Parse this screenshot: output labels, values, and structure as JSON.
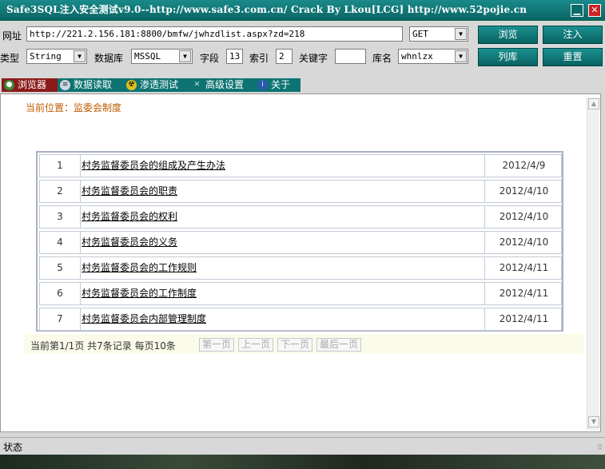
{
  "window": {
    "title": "Safe3SQL注入安全测试v9.0--http://www.safe3.com.cn/   Crack By Lkou[LCG]  http://www.52pojie.cn",
    "minimize_glyph": "▁",
    "close_glyph": "✕"
  },
  "toolbar": {
    "url_label": "网址",
    "url_value": "http://221.2.156.181:8800/bmfw/jwhzdlist.aspx?zd=218",
    "method_value": "GET",
    "type_label": "类型",
    "type_value": "String",
    "db_label": "数据库",
    "db_value": "MSSQL",
    "field_label": "字段",
    "field_value": "13",
    "index_label": "索引",
    "index_value": "2",
    "keyword_label": "关键字",
    "keyword_value": "",
    "dbname_label": "库名",
    "dbname_value": "whnlzx",
    "browse_btn": "浏览",
    "inject_btn": "注入",
    "listdb_btn": "列库",
    "reset_btn": "重置",
    "arrow_glyph": "▼"
  },
  "tabs": [
    {
      "label": "浏览器",
      "icon": "globe-icon",
      "glyph": "●"
    },
    {
      "label": "数据读取",
      "icon": "database-icon",
      "glyph": "≡"
    },
    {
      "label": "渗透测试",
      "icon": "radiation-icon",
      "glyph": "☢"
    },
    {
      "label": "高级设置",
      "icon": "tools-icon",
      "glyph": "✕"
    },
    {
      "label": "关于",
      "icon": "info-icon",
      "glyph": "i"
    }
  ],
  "page": {
    "location": "当前位置：监委会制度",
    "rows": [
      {
        "num": "1",
        "title": "村务监督委员会的组成及产生办法",
        "date": "2012/4/9"
      },
      {
        "num": "2",
        "title": "村务监督委员会的职责",
        "date": "2012/4/10"
      },
      {
        "num": "3",
        "title": "村务监督委员会的权利",
        "date": "2012/4/10"
      },
      {
        "num": "4",
        "title": "村务监督委员会的义务",
        "date": "2012/4/10"
      },
      {
        "num": "5",
        "title": "村务监督委员会的工作规则",
        "date": "2012/4/11"
      },
      {
        "num": "6",
        "title": "村务监督委员会的工作制度",
        "date": "2012/4/11"
      },
      {
        "num": "7",
        "title": "村务监督委员会内部管理制度",
        "date": "2012/4/11"
      }
    ],
    "pager_info": "当前第1/1页  共7条记录  每页10条",
    "first_page": "第一页",
    "prev_page": "上一页",
    "next_page": "下一页",
    "last_page": "最后一页"
  },
  "scroll": {
    "up_glyph": "▲",
    "down_glyph": "▼"
  },
  "status": {
    "label": "状态",
    "grip": "⠿"
  },
  "colors": {
    "accent": "#0d7373",
    "active_tab": "#8b1a1a",
    "location_text": "#c05a00"
  }
}
